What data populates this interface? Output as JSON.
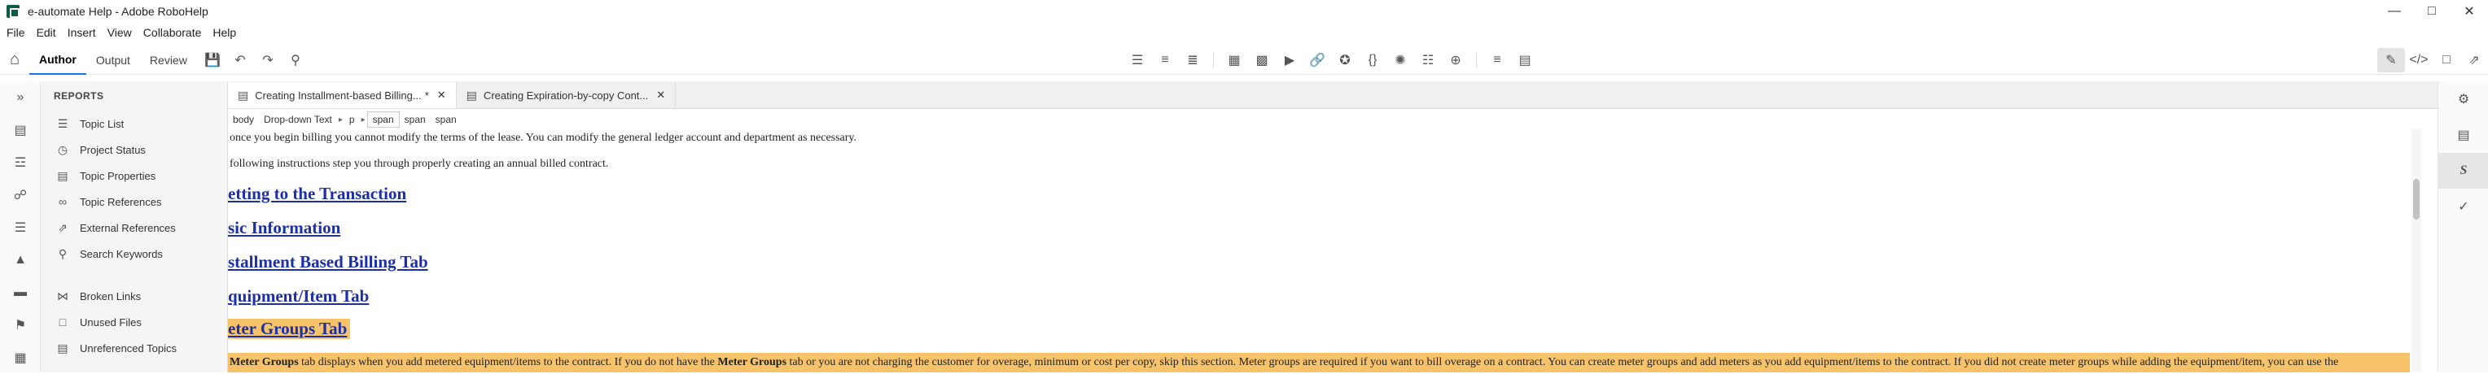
{
  "window": {
    "title": "e-automate Help - Adobe RoboHelp"
  },
  "menu": [
    "File",
    "Edit",
    "Insert",
    "View",
    "Collaborate",
    "Help"
  ],
  "toolbar": {
    "modes": [
      "Author",
      "Output",
      "Review"
    ]
  },
  "reports": {
    "header": "REPORTS",
    "items": [
      "Topic List",
      "Project Status",
      "Topic Properties",
      "Topic References",
      "External References",
      "Search Keywords"
    ],
    "items2": [
      "Broken Links",
      "Unused Files",
      "Unreferenced Topics"
    ]
  },
  "tabs": [
    {
      "label": "Creating Installment-based Billing...",
      "modified": "*"
    },
    {
      "label": "Creating Expiration-by-copy Cont..."
    }
  ],
  "breadcrumb": [
    "body",
    "Drop-down Text",
    "p",
    "span",
    "span",
    "span"
  ],
  "doc": {
    "line1": "once you begin billing you cannot modify the terms of the lease. You can modify the general ledger account and department as necessary.",
    "line2": "following instructions step you through properly creating an annual billed contract.",
    "headings": [
      "etting to the Transaction",
      "sic Information",
      "stallment Based Billing Tab",
      "quipment/Item Tab",
      "eter Groups Tab"
    ],
    "meter": {
      "b1": "Meter Groups",
      "t1": " tab displays when you add metered equipment/items to the contract. If you do not have the ",
      "b2": "Meter Groups",
      "t2": " tab or you are not charging the customer for overage, minimum or cost per copy, skip this section. Meter groups are required if you want to bill overage on a contract. You can create meter groups and add meters as you add equipment/items to the contract. If you did not create meter groups while adding the equipment/item, you can use the"
    }
  },
  "colors": {
    "link": "#1c2fa6",
    "highlight": "#f6c36a",
    "accent": "#1473e6"
  }
}
